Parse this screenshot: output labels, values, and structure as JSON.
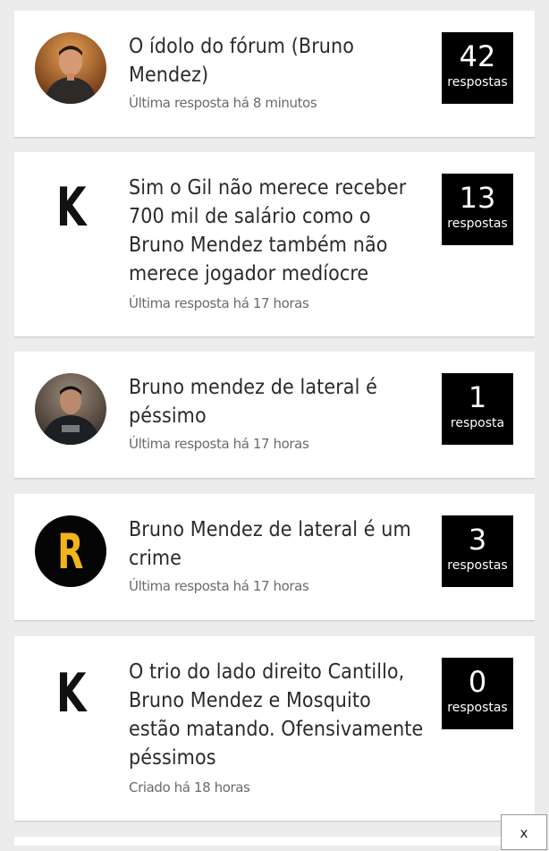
{
  "threads": [
    {
      "title": "O ídolo do fórum (Bruno Mendez)",
      "meta": "Última resposta há 8 minutos",
      "count": "42",
      "count_label": "respostas",
      "avatar": "photo-icon"
    },
    {
      "title": "Sim o Gil não merece receber 700 mil de salário como o Bruno Mendez também não merece jogador medíocre",
      "meta": "Última resposta há 17 horas",
      "count": "13",
      "count_label": "respostas",
      "avatar_letter": "K"
    },
    {
      "title": "Bruno mendez de lateral é péssimo",
      "meta": "Última resposta há 17 horas",
      "count": "1",
      "count_label": "resposta",
      "avatar": "photo-icon"
    },
    {
      "title": "Bruno Mendez de lateral é um crime",
      "meta": "Última resposta há 17 horas",
      "count": "3",
      "count_label": "respostas",
      "avatar_letter": "R"
    },
    {
      "title": "O trio do lado direito Cantillo, Bruno Mendez e Mosquito estão matando. Ofensivamente péssimos",
      "meta": "Criado há 18 horas",
      "count": "0",
      "count_label": "respostas",
      "avatar_letter": "K"
    }
  ],
  "close_label": "x",
  "colors": {
    "background": "#ececec",
    "card": "#ffffff",
    "count_box": "#000000",
    "r_letter": "#f0b41c"
  }
}
